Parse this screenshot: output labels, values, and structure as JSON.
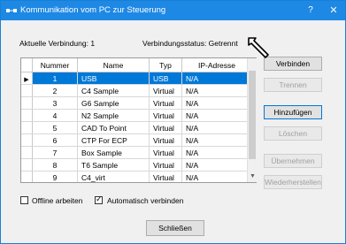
{
  "window": {
    "title": "Kommunikation vom PC zur Steuerung",
    "help_label": "?",
    "close_label": "✕",
    "title_bg": "#1e88e5"
  },
  "status": {
    "connection_label": "Aktuelle Verbindung: 1",
    "state_label": "Verbindungsstatus: Getrennt"
  },
  "table": {
    "headers": [
      "Nummer",
      "Name",
      "Typ",
      "IP-Adresse"
    ],
    "selected_index": 0,
    "rows": [
      {
        "num": "1",
        "name": "USB",
        "type": "USB",
        "ip": "N/A"
      },
      {
        "num": "2",
        "name": "C4 Sample",
        "type": "Virtual",
        "ip": "N/A"
      },
      {
        "num": "3",
        "name": "G6 Sample",
        "type": "Virtual",
        "ip": "N/A"
      },
      {
        "num": "4",
        "name": "N2 Sample",
        "type": "Virtual",
        "ip": "N/A"
      },
      {
        "num": "5",
        "name": "CAD To Point",
        "type": "Virtual",
        "ip": "N/A"
      },
      {
        "num": "6",
        "name": "CTP For ECP",
        "type": "Virtual",
        "ip": "N/A"
      },
      {
        "num": "7",
        "name": "Box Sample",
        "type": "Virtual",
        "ip": "N/A"
      },
      {
        "num": "8",
        "name": "T6 Sample",
        "type": "Virtual",
        "ip": "N/A"
      },
      {
        "num": "9",
        "name": "C4_virt",
        "type": "Virtual",
        "ip": "N/A"
      }
    ]
  },
  "buttons": {
    "connect": "Verbinden",
    "disconnect": "Trennen",
    "add": "Hinzufügen",
    "delete": "Löschen",
    "apply": "Übernehmen",
    "restore": "Wiederherstellen",
    "close": "Schließen"
  },
  "options": {
    "offline_label": "Offline arbeiten",
    "offline_checked": false,
    "auto_connect_label": "Automatisch verbinden",
    "auto_connect_checked": true
  }
}
